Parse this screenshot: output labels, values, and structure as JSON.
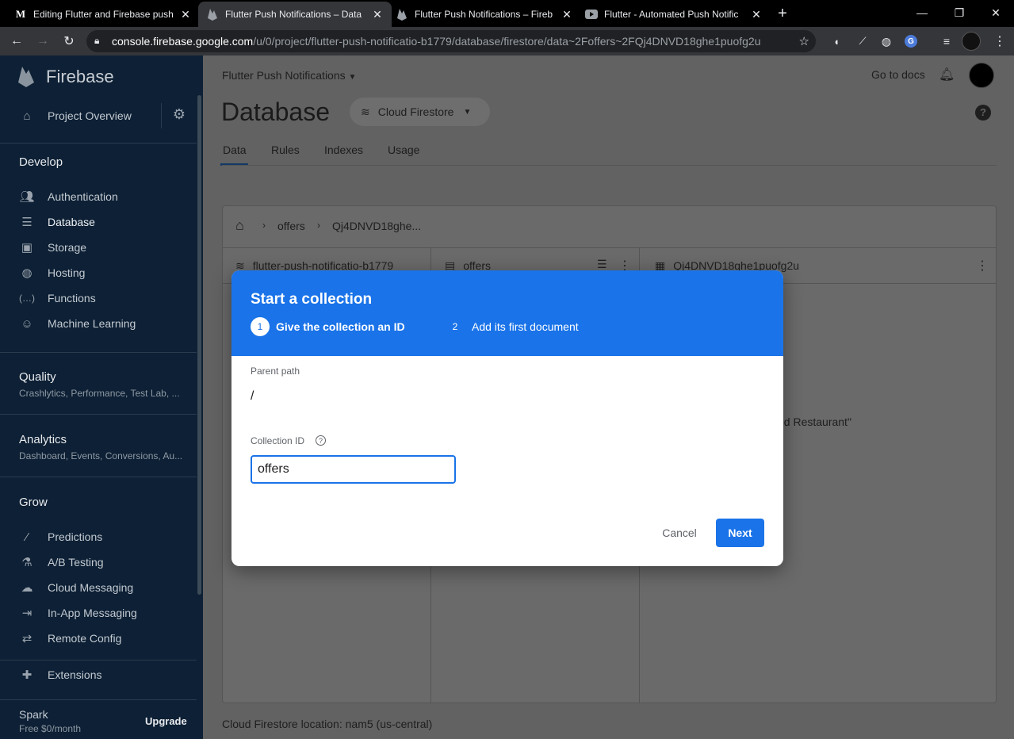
{
  "browser": {
    "tabs": [
      {
        "favicon": "M",
        "title": "Editing Flutter and Firebase push"
      },
      {
        "favicon": "firebase-icon",
        "title": "Flutter Push Notifications – Data"
      },
      {
        "favicon": "firebase-icon",
        "title": "Flutter Push Notifications – Fireb"
      },
      {
        "favicon": "youtube-icon",
        "title": "Flutter - Automated Push Notific"
      }
    ],
    "url_host": "console.firebase.google.com",
    "url_path": "/u/0/project/flutter-push-notificatio-b1779/database/firestore/data~2Foffers~2FQj4DNVD18ghe1puofg2u"
  },
  "sidebar": {
    "brand": "Firebase",
    "overview": "Project Overview",
    "develop": {
      "title": "Develop",
      "items": [
        {
          "label": "Authentication",
          "icon": "people-icon"
        },
        {
          "label": "Database",
          "icon": "database-icon"
        },
        {
          "label": "Storage",
          "icon": "storage-icon"
        },
        {
          "label": "Hosting",
          "icon": "globe-icon"
        },
        {
          "label": "Functions",
          "icon": "functions-icon"
        },
        {
          "label": "Machine Learning",
          "icon": "robot-icon"
        }
      ]
    },
    "quality": {
      "title": "Quality",
      "subtitle": "Crashlytics, Performance, Test Lab, ..."
    },
    "analytics": {
      "title": "Analytics",
      "subtitle": "Dashboard, Events, Conversions, Au..."
    },
    "grow": {
      "title": "Grow",
      "items": [
        {
          "label": "Predictions",
          "icon": "wand-icon"
        },
        {
          "label": "A/B Testing",
          "icon": "flask-icon"
        },
        {
          "label": "Cloud Messaging",
          "icon": "cloud-icon"
        },
        {
          "label": "In-App Messaging",
          "icon": "inapp-icon"
        },
        {
          "label": "Remote Config",
          "icon": "config-icon"
        }
      ]
    },
    "extensions": "Extensions",
    "plan": {
      "name": "Spark",
      "price": "Free $0/month",
      "upgrade": "Upgrade"
    }
  },
  "header": {
    "project": "Flutter Push Notifications",
    "docs": "Go to docs",
    "title": "Database",
    "db_selector": "Cloud Firestore",
    "tabs": [
      "Data",
      "Rules",
      "Indexes",
      "Usage"
    ]
  },
  "data_panel": {
    "breadcrumb": [
      "offers",
      "Qj4DNVD18ghe..."
    ],
    "col1_title": "flutter-push-notificatio-b1779",
    "col2_title": "offers",
    "col3_title": "Qj4DNVD18ghe1puofg2u",
    "field_fragment": "od Restaurant\""
  },
  "modal": {
    "title": "Start a collection",
    "step1_num": "1",
    "step1_label": "Give the collection an ID",
    "step2_num": "2",
    "step2_label": "Add its first document",
    "parent_path_label": "Parent path",
    "parent_path_value": "/",
    "collection_id_label": "Collection ID",
    "collection_id_value": "offers",
    "cancel": "Cancel",
    "next": "Next"
  },
  "footer": {
    "location": "Cloud Firestore location: nam5 (us-central)"
  }
}
